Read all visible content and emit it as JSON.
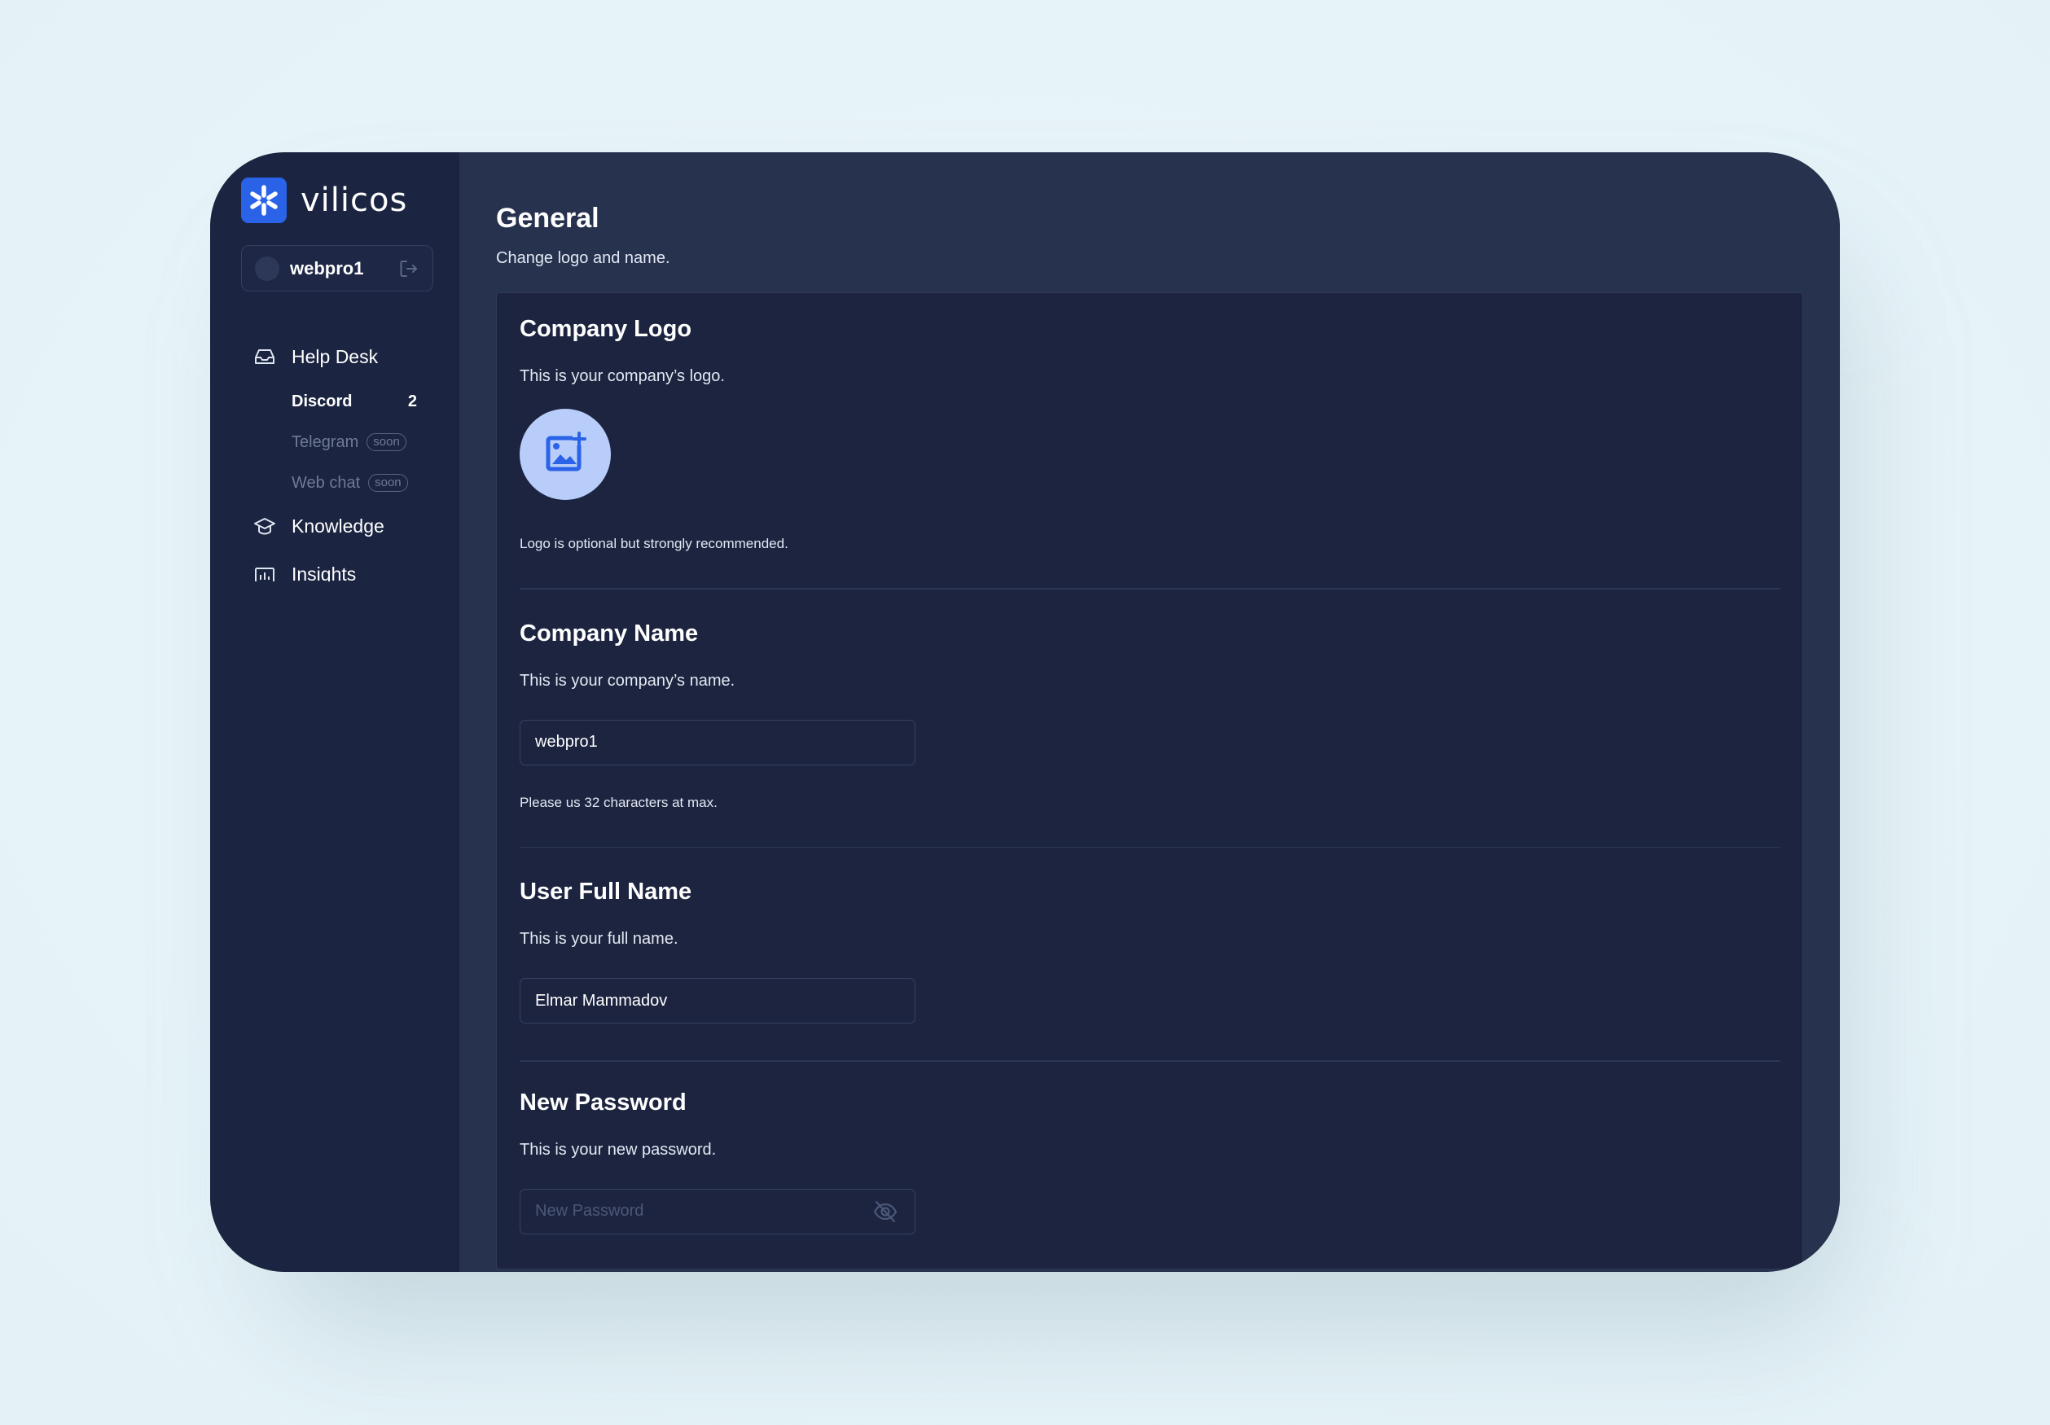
{
  "app": {
    "brand_name": "vilicos"
  },
  "account": {
    "username": "webpro1"
  },
  "sidebar": {
    "help_desk": {
      "label": "Help Desk",
      "items": [
        {
          "label": "Discord",
          "count": "2"
        },
        {
          "label": "Telegram",
          "badge": "soon"
        },
        {
          "label": "Web chat",
          "badge": "soon"
        }
      ]
    },
    "knowledge": {
      "label": "Knowledge"
    },
    "insights": {
      "label": "Insights"
    }
  },
  "page": {
    "title": "General",
    "subtitle": "Change logo and name."
  },
  "sections": {
    "company_logo": {
      "title": "Company Logo",
      "description": "This is your company’s logo.",
      "hint": "Logo is optional but strongly recommended."
    },
    "company_name": {
      "title": "Company Name",
      "description": "This is your company’s name.",
      "value": "webpro1",
      "hint": "Please us 32 characters at max."
    },
    "user_full_name": {
      "title": "User Full Name",
      "description": "This is your full name.",
      "value": "Elmar Mammadov"
    },
    "new_password": {
      "title": "New Password",
      "description": "This is your new password.",
      "placeholder": "New Password"
    }
  },
  "colors": {
    "accent": "#2a63e8",
    "sidebar_bg": "#1b2440",
    "main_bg": "#27324e",
    "card_bg": "#1c2440",
    "logo_upload_bg": "#b9cdfa"
  },
  "icons": {
    "brand": "vilicos-logo-icon",
    "logout": "logout-icon",
    "help_desk": "inbox-icon",
    "knowledge": "graduation-cap-icon",
    "insights": "chart-icon",
    "logo_upload": "image-add-icon",
    "password_toggle": "eye-off-icon"
  }
}
